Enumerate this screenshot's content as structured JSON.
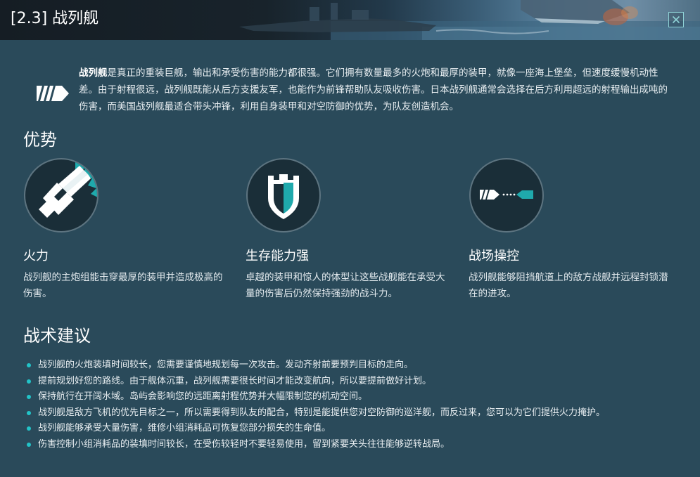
{
  "header": {
    "title": "[2.3] 战列舰",
    "close_icon": "close-icon"
  },
  "intro": {
    "icon": "battleship-class-icon",
    "bold_term": "战列舰",
    "text": "是真正的重装巨舰，输出和承受伤害的能力都很强。它们拥有数量最多的火炮和最厚的装甲，就像一座海上堡垒，但速度缓慢机动性差。由于射程很远，战列舰既能从后方支援友军，也能作为前锋帮助队友吸收伤害。日本战列舰通常会选择在后方利用超远的射程输出成吨的伤害，而美国战列舰最适合带头冲锋，利用自身装甲和对空防御的优势，为队友创造机会。"
  },
  "advantages": {
    "title": "优势",
    "items": [
      {
        "icon": "firepower-icon",
        "title": "火力",
        "desc": "战列舰的主炮组能击穿最厚的装甲并造成极高的伤害。"
      },
      {
        "icon": "shield-icon",
        "title": "生存能力强",
        "desc": "卓越的装甲和惊人的体型让这些战舰能在承受大量的伤害后仍然保持强劲的战斗力。"
      },
      {
        "icon": "area-control-icon",
        "title": "战场操控",
        "desc": "战列舰能够阻挡航道上的敌方战舰并远程封锁潜在的进攻。"
      }
    ]
  },
  "tactics": {
    "title": "战术建议",
    "items": [
      "战列舰的火炮装填时间较长，您需要谨慎地规划每一次攻击。发动齐射前要预判目标的走向。",
      "提前规划好您的路线。由于舰体沉重，战列舰需要很长时间才能改变航向，所以要提前做好计划。",
      "保持航行在开阔水域。岛屿会影响您的远距离射程优势并大幅限制您的机动空间。",
      "战列舰是敌方飞机的优先目标之一，所以需要得到队友的配合，特别是能提供您对空防御的巡洋舰，而反过来，您可以为它们提供火力掩护。",
      "战列舰能够承受大量伤害，维修小组消耗品可恢复您部分损失的生命值。",
      "伤害控制小组消耗品的装填时间较长，在受伤较轻时不要轻易使用，留到紧要关头往往能够逆转战局。"
    ]
  },
  "colors": {
    "background": "#2a4a5a",
    "accent": "#1fa9ac",
    "bullet": "#22c4c8",
    "circle_fill": "#1a2e38"
  }
}
